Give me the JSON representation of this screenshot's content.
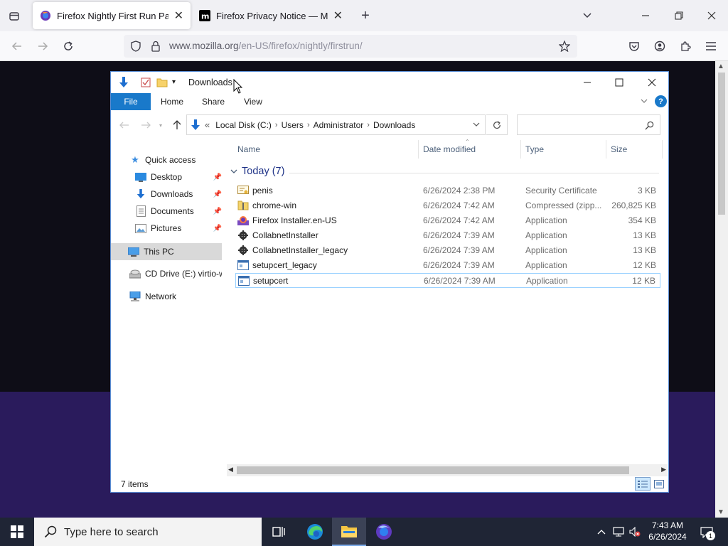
{
  "browser": {
    "tabs": [
      {
        "title": "Firefox Nightly First Run Page",
        "active": true
      },
      {
        "title": "Firefox Privacy Notice — Mozill",
        "active": false
      }
    ],
    "url_host": "www.mozilla.org",
    "url_path": "/en-US/firefox/nightly/firstrun/"
  },
  "explorer": {
    "title": "Downloads",
    "ribbon_tabs": [
      "File",
      "Home",
      "Share",
      "View"
    ],
    "breadcrumb": [
      "Local Disk (C:)",
      "Users",
      "Administrator",
      "Downloads"
    ],
    "breadcrumb_prefix": "«",
    "search_placeholder": "",
    "nav": {
      "quick_access": "Quick access",
      "desktop": "Desktop",
      "downloads": "Downloads",
      "documents": "Documents",
      "pictures": "Pictures",
      "this_pc": "This PC",
      "cd_drive": "CD Drive (E:) virtio-w",
      "network": "Network"
    },
    "columns": {
      "name": "Name",
      "date": "Date modified",
      "type": "Type",
      "size": "Size"
    },
    "group_label": "Today (7)",
    "files": [
      {
        "name": "penis",
        "date": "6/26/2024 2:38 PM",
        "type": "Security Certificate",
        "size": "3 KB",
        "icon": "certificate-icon"
      },
      {
        "name": "chrome-win",
        "date": "6/26/2024 7:42 AM",
        "type": "Compressed (zipp...",
        "size": "260,825 KB",
        "icon": "zip-icon"
      },
      {
        "name": "Firefox Installer.en-US",
        "date": "6/26/2024 7:42 AM",
        "type": "Application",
        "size": "354 KB",
        "icon": "firefox-installer-icon"
      },
      {
        "name": "CollabnetInstaller",
        "date": "6/26/2024 7:39 AM",
        "type": "Application",
        "size": "13 KB",
        "icon": "gear-app-icon"
      },
      {
        "name": "CollabnetInstaller_legacy",
        "date": "6/26/2024 7:39 AM",
        "type": "Application",
        "size": "13 KB",
        "icon": "gear-app-icon"
      },
      {
        "name": "setupcert_legacy",
        "date": "6/26/2024 7:39 AM",
        "type": "Application",
        "size": "12 KB",
        "icon": "app-window-icon"
      },
      {
        "name": "setupcert",
        "date": "6/26/2024 7:39 AM",
        "type": "Application",
        "size": "12 KB",
        "icon": "app-window-icon"
      }
    ],
    "status": "7 items"
  },
  "taskbar": {
    "search_placeholder": "Type here to search",
    "time": "7:43 AM",
    "date": "6/26/2024",
    "notification_count": "1"
  },
  "colors": {
    "accent": "#1979ca",
    "taskbar": "#1f2535",
    "firefox_tabstrip": "#f0f0f4"
  }
}
